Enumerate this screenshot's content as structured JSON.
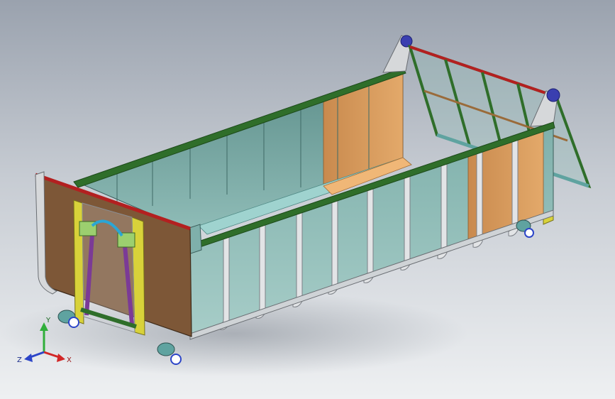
{
  "viewport": {
    "model": "hook-lift-container",
    "background_top": "#9aa2ae",
    "background_bottom": "#eef0f2"
  },
  "colors": {
    "rim_green": "#2f6e2a",
    "rim_red": "#b32020",
    "wall_teal": "#6f9f9b",
    "liner_orange": "#d89a5c",
    "end_brown": "#7d5737",
    "post_yellow": "#d8d23a",
    "rib_grey": "#e2e4e6",
    "hinge_blue": "#3a3fb0",
    "cylinder_purple": "#7b3a96",
    "gate_teal": "#5fa3a0"
  },
  "triad": {
    "y_label": "Y",
    "x_label": "X",
    "z_label": "Z",
    "y_color": "#2fae3a",
    "x_color": "#d22626",
    "z_color": "#2c45c8"
  }
}
